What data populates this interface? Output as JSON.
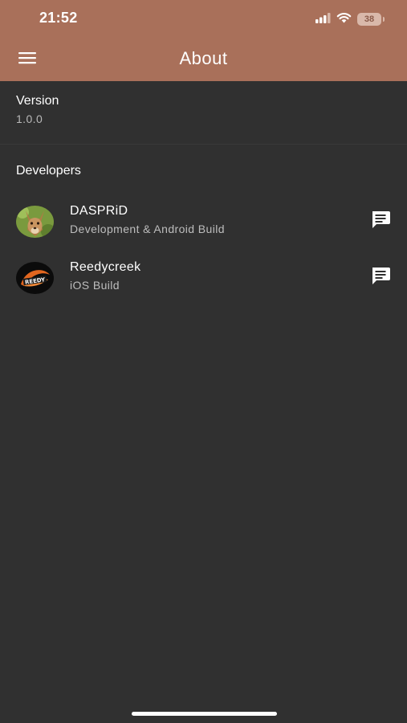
{
  "status_bar": {
    "time": "21:52",
    "battery": "38",
    "icons": [
      "signal-icon",
      "wifi-icon",
      "battery-icon"
    ]
  },
  "app_bar": {
    "title": "About",
    "menu_icon": "menu-icon",
    "color": "#a9705a"
  },
  "version": {
    "label": "Version",
    "value": "1.0.0"
  },
  "developers": {
    "header": "Developers",
    "items": [
      {
        "name": "DASPRiD",
        "role": "Development & Android Build",
        "action_icon": "message-icon"
      },
      {
        "name": "Reedycreek",
        "role": "iOS Build",
        "action_icon": "message-icon"
      }
    ]
  },
  "colors": {
    "background": "#303030",
    "text_primary": "#ffffff",
    "text_secondary": "#bdbdbd"
  }
}
